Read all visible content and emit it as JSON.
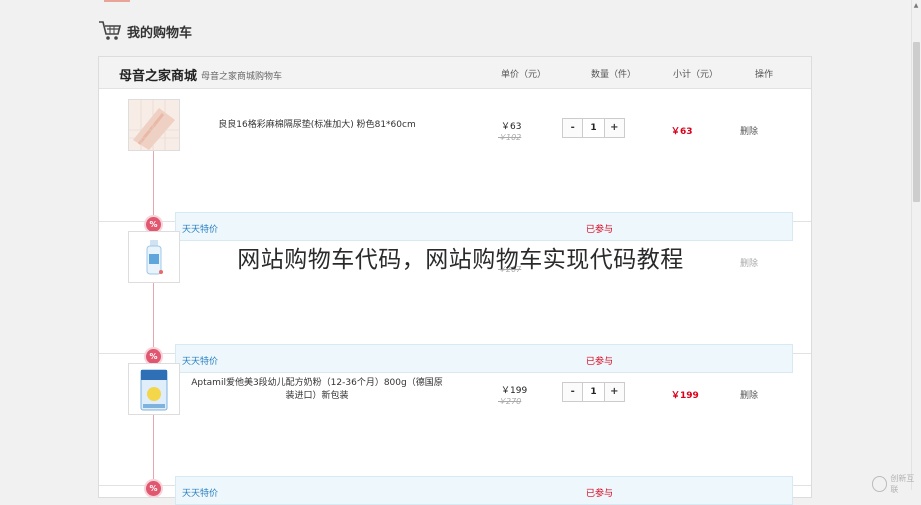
{
  "page": {
    "title": "我的购物车",
    "overlay_caption": "网站购物车代码，网站购物车实现代码教程"
  },
  "shop": {
    "name": "母音之家商城",
    "subtitle": "母音之家商城购物车"
  },
  "columns": {
    "price": "单价（元）",
    "qty": "数量（件）",
    "subtotal": "小计（元）",
    "op": "操作"
  },
  "items": [
    {
      "name": "良良16格彩麻棉隔尿垫(标准加大) 粉色81*60cm",
      "price": "￥63",
      "price_old": "￥102",
      "minus": "-",
      "qty": "1",
      "plus": "+",
      "subtotal": "￥63",
      "delete": "删除",
      "promo": "天天特价",
      "promo_status": "已参与",
      "promo_badge": "%"
    },
    {
      "name": "",
      "price": "",
      "price_old": "￥207",
      "minus": "",
      "qty": "",
      "plus": "",
      "subtotal": "",
      "delete": "删除",
      "promo": "天天特价",
      "promo_status": "已参与",
      "promo_badge": "%"
    },
    {
      "name": "Aptamil爱他美3段幼儿配方奶粉（12-36个月）800g（德国原装进口）新包装",
      "price": "￥199",
      "price_old": "￥270",
      "minus": "-",
      "qty": "1",
      "plus": "+",
      "subtotal": "￥199",
      "delete": "删除",
      "promo": "天天特价",
      "promo_status": "已参与",
      "promo_badge": "%"
    }
  ],
  "watermark": "创新互联",
  "colors": {
    "accent_red": "#d9001b",
    "promo_blue": "#2a7fc1",
    "promo_bg": "#edf7fc",
    "badge_pink": "#e0576f"
  }
}
